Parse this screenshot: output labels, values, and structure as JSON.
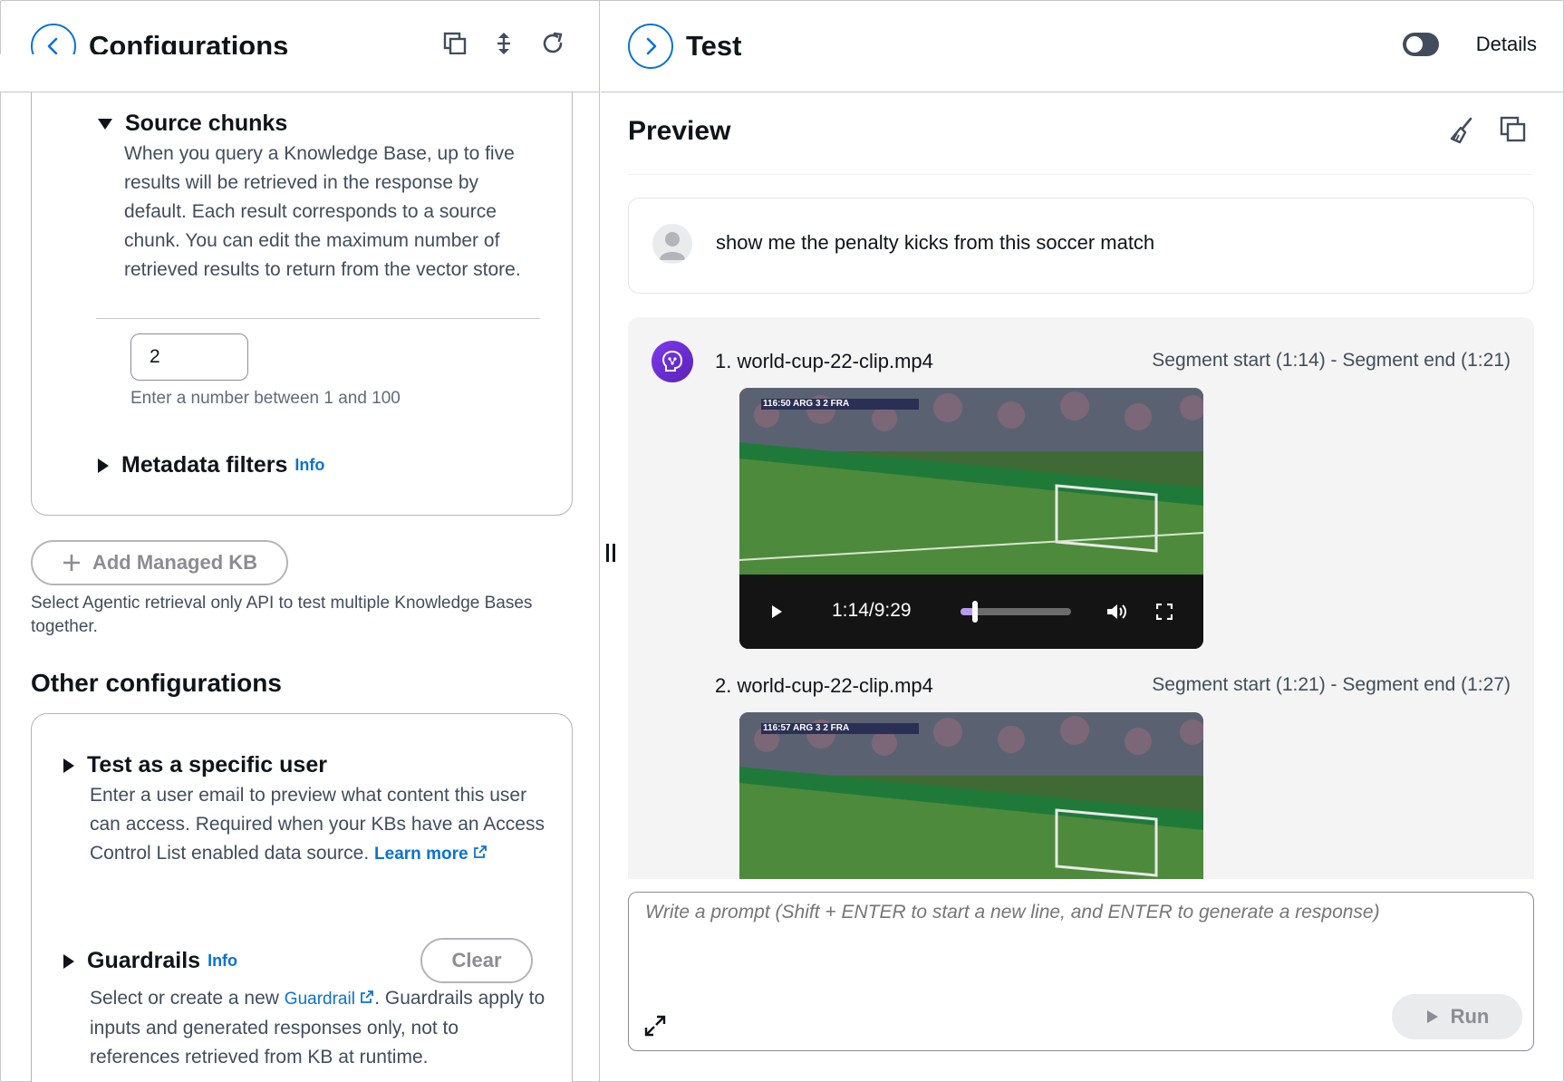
{
  "left_panel": {
    "title": "Configurations",
    "icons": [
      "copy-icon",
      "expand-collapse-icon",
      "refresh-icon"
    ],
    "source_chunks": {
      "title": "Source chunks",
      "description": "When you query a Knowledge Base, up to five results will be retrieved in the response by default. Each result corresponds to a source chunk. You can edit the maximum number of retrieved results to return from the vector store.",
      "value": "2",
      "hint": "Enter a number between 1 and 100"
    },
    "metadata_filters": {
      "title": "Metadata filters",
      "info": "Info"
    },
    "add_kb_button": "Add Managed KB",
    "add_kb_hint": "Select Agentic retrieval only API to test multiple Knowledge Bases together.",
    "other_heading": "Other configurations",
    "test_user": {
      "title": "Test as a specific user",
      "description": "Enter a user email to preview what content this user can access. Required when your KBs have an Access Control List enabled data source.",
      "learn_more": "Learn more"
    },
    "guardrails": {
      "title": "Guardrails",
      "info": "Info",
      "clear_button": "Clear",
      "desc_prefix": "Select or create a new",
      "desc_link": "Guardrail",
      "desc_suffix": ". Guardrails apply to inputs and generated responses only, not to references retrieved from KB at runtime."
    }
  },
  "right_panel": {
    "title": "Test",
    "details_toggle": "Details",
    "preview_title": "Preview",
    "user_message": "show me the penalty kicks from this soccer match",
    "results": [
      {
        "name": "1. world-cup-22-clip.mp4",
        "segment": "Segment start (1:14) - Segment end (1:21)",
        "scorebug": "116:50 ARG 3 2 FRA"
      },
      {
        "name": "2. world-cup-22-clip.mp4",
        "segment": "Segment start (1:21) - Segment end (1:27)",
        "scorebug": "116:57 ARG 3 2 FRA"
      }
    ],
    "video_player": {
      "time": "1:14/9:29",
      "progress": 0.13
    },
    "prompt_placeholder": "Write a prompt (Shift + ENTER to start a new line, and ENTER to generate a response)",
    "run_button": "Run"
  }
}
